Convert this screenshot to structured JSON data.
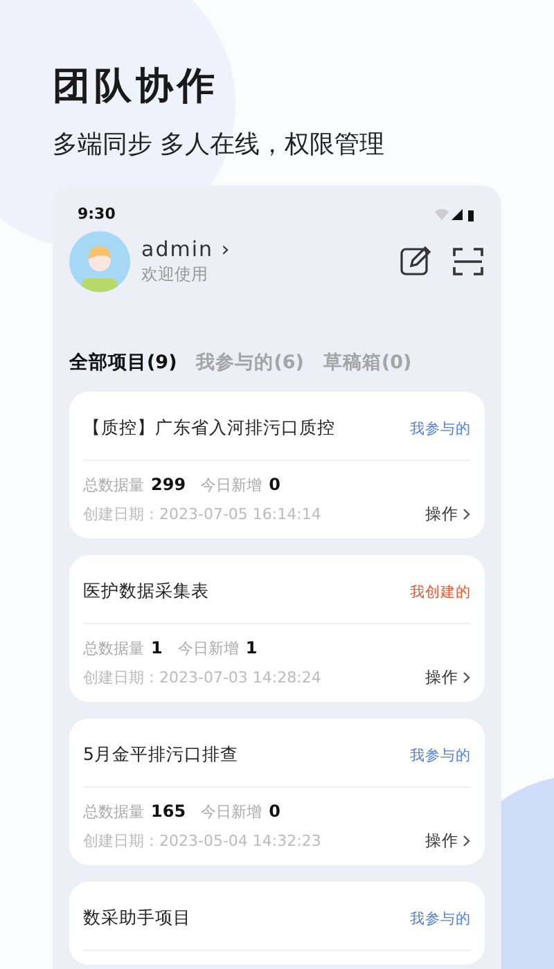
{
  "header": {
    "title": "团队协作",
    "subtitle": "多端同步 多人在线，权限管理"
  },
  "status_bar": {
    "time": "9:30"
  },
  "user": {
    "name": "admin",
    "chevron": "›",
    "greeting": "欢迎使用"
  },
  "tabs": [
    {
      "label": "全部项目(9)",
      "selected": true
    },
    {
      "label": "我参与的(6)",
      "selected": false
    },
    {
      "label": "草稿箱(0)",
      "selected": false
    }
  ],
  "projects": [
    {
      "title": "【质控】广东省入河排污口质控",
      "tag": "我参与的",
      "kind": "joined",
      "total_label": "总数据量",
      "total": "299",
      "today_label": "今日新增",
      "today": "0",
      "date": "创建日期：2023-07-05 16:14:14",
      "action": "操作"
    },
    {
      "title": "医护数据采集表",
      "tag": "我创建的",
      "kind": "created",
      "total_label": "总数据量",
      "total": "1",
      "today_label": "今日新增",
      "today": "1",
      "date": "创建日期：2023-07-03 14:28:24",
      "action": "操作"
    },
    {
      "title": "5月金平排污口排查",
      "tag": "我参与的",
      "kind": "joined",
      "total_label": "总数据量",
      "total": "165",
      "today_label": "今日新增",
      "today": "0",
      "date": "创建日期：2023-05-04 14:32:23",
      "action": "操作"
    },
    {
      "title": "数采助手项目",
      "tag": "我参与的",
      "kind": "joined"
    }
  ]
}
